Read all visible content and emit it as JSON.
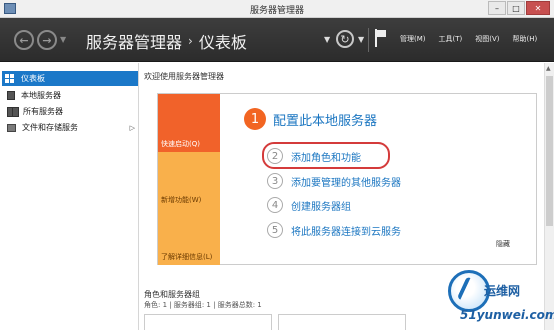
{
  "window": {
    "title": "服务器管理器",
    "controls": {
      "minimize": "–",
      "maximize": "□",
      "close": "✕"
    }
  },
  "header": {
    "breadcrumb_root": "服务器管理器",
    "breadcrumb_sep": "›",
    "breadcrumb_current": "仪表板",
    "menus": [
      "管理(M)",
      "工具(T)",
      "视图(V)",
      "帮助(H)"
    ]
  },
  "sidebar": {
    "items": [
      {
        "label": "仪表板",
        "icon": "dashboard-icon",
        "active": true
      },
      {
        "label": "本地服务器",
        "icon": "server-icon",
        "active": false
      },
      {
        "label": "所有服务器",
        "icon": "servers-icon",
        "active": false
      },
      {
        "label": "文件和存储服务",
        "icon": "storage-icon",
        "active": false,
        "has_children": true,
        "chevron": "▷"
      }
    ]
  },
  "main": {
    "welcome_title": "欢迎使用服务器管理器",
    "tiles": [
      "快速启动(Q)",
      "新增功能(W)",
      "了解详细信息(L)"
    ],
    "primary_step": {
      "number": "1",
      "label": "配置此本地服务器"
    },
    "steps": [
      {
        "number": "2",
        "label": "添加角色和功能"
      },
      {
        "number": "3",
        "label": "添加要管理的其他服务器"
      },
      {
        "number": "4",
        "label": "创建服务器组"
      },
      {
        "number": "5",
        "label": "将此服务器连接到云服务"
      }
    ],
    "hide_label": "隐藏",
    "roles_title": "角色和服务器组",
    "roles_summary": "角色: 1 | 服务器组: 1 | 服务器总数: 1"
  },
  "watermark": {
    "brand": "运维网",
    "site": "51yunwei.com"
  },
  "colors": {
    "accent_blue": "#1b78c8",
    "tile_orange": "#f1622a",
    "tile_yellow": "#f9b04b",
    "highlight_red": "#d43b3b"
  }
}
